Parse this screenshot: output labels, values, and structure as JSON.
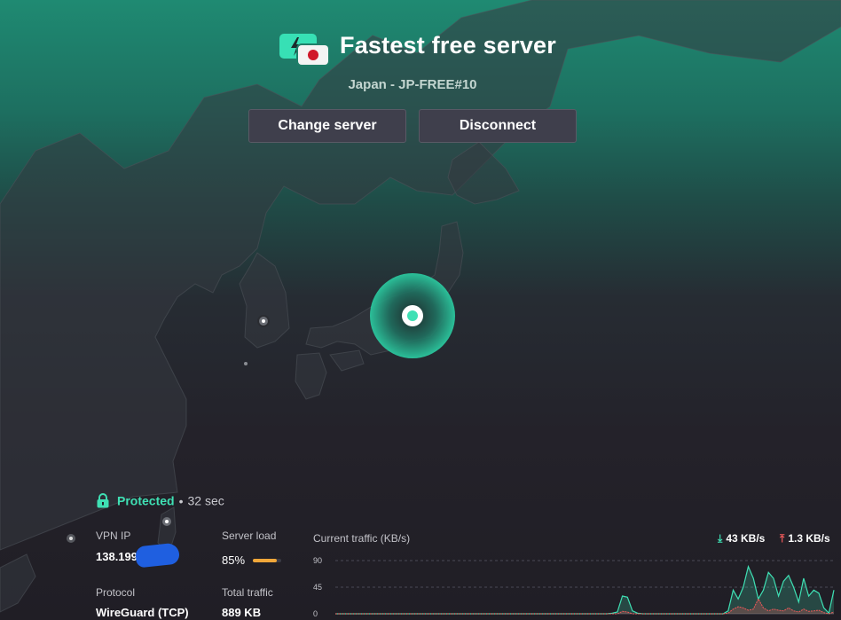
{
  "header": {
    "title": "Fastest free server",
    "subtitle": "Japan - JP-FREE#10",
    "change_server_label": "Change server",
    "disconnect_label": "Disconnect"
  },
  "status": {
    "protected_label": "Protected",
    "separator": "•",
    "duration": "32 sec"
  },
  "info": {
    "vpn_ip_label": "VPN IP",
    "vpn_ip_value": "138.199.",
    "server_load_label": "Server load",
    "server_load_value": "85%",
    "server_load_fraction": 0.85,
    "protocol_label": "Protocol",
    "protocol_value": "WireGuard (TCP)",
    "total_traffic_label": "Total traffic",
    "total_traffic_value": "889 KB"
  },
  "traffic": {
    "title": "Current traffic (KB/s)",
    "download_rate": "43 KB/s",
    "upload_rate": "1.3 KB/s",
    "y_ticks": [
      "90",
      "45",
      "0"
    ]
  },
  "chart_data": {
    "type": "area",
    "title": "Current traffic (KB/s)",
    "ylim": [
      0,
      90
    ],
    "y_ticks": [
      90,
      45,
      0
    ],
    "grid": true,
    "series": [
      {
        "values": [
          0,
          0,
          0,
          0,
          0,
          0,
          0,
          0,
          0,
          0,
          0,
          0,
          0,
          0,
          0,
          0,
          0,
          0,
          0,
          0,
          0,
          0,
          0,
          0,
          0,
          0,
          0,
          0,
          0,
          0,
          0,
          0,
          0,
          0,
          0,
          0,
          0,
          0,
          0,
          0,
          0,
          0,
          0,
          0,
          0,
          0,
          0,
          0,
          0,
          0,
          0,
          0,
          0,
          0,
          0,
          1,
          3,
          30,
          28,
          5,
          1,
          0,
          0,
          0,
          0,
          0,
          0,
          0,
          0,
          0,
          0,
          0,
          0,
          0,
          0,
          0,
          0,
          0,
          5,
          40,
          25,
          45,
          80,
          60,
          25,
          40,
          70,
          60,
          30,
          55,
          65,
          45,
          20,
          60,
          30,
          40,
          35,
          10,
          1,
          40
        ]
      },
      {
        "values": [
          0,
          0,
          0,
          0,
          0,
          0,
          0,
          0,
          0,
          0,
          0,
          0,
          0,
          0,
          0,
          0,
          0,
          0,
          0,
          0,
          0,
          0,
          0,
          0,
          0,
          0,
          0,
          0,
          0,
          0,
          0,
          0,
          0,
          0,
          0,
          0,
          0,
          0,
          0,
          0,
          0,
          0,
          0,
          0,
          0,
          0,
          0,
          0,
          0,
          0,
          0,
          0,
          0,
          0,
          0,
          0,
          0,
          4,
          3,
          0,
          0,
          0,
          0,
          0,
          0,
          0,
          0,
          0,
          0,
          0,
          0,
          0,
          0,
          0,
          0,
          0,
          0,
          0,
          1,
          8,
          12,
          10,
          6,
          8,
          25,
          10,
          5,
          8,
          6,
          5,
          10,
          5,
          3,
          8,
          4,
          5,
          6,
          2,
          0,
          3
        ]
      }
    ],
    "colors": {
      "download": "#3fe0b4",
      "upload": "#f05a5a"
    }
  },
  "map": {
    "marker_color": "#3fe0b4"
  }
}
